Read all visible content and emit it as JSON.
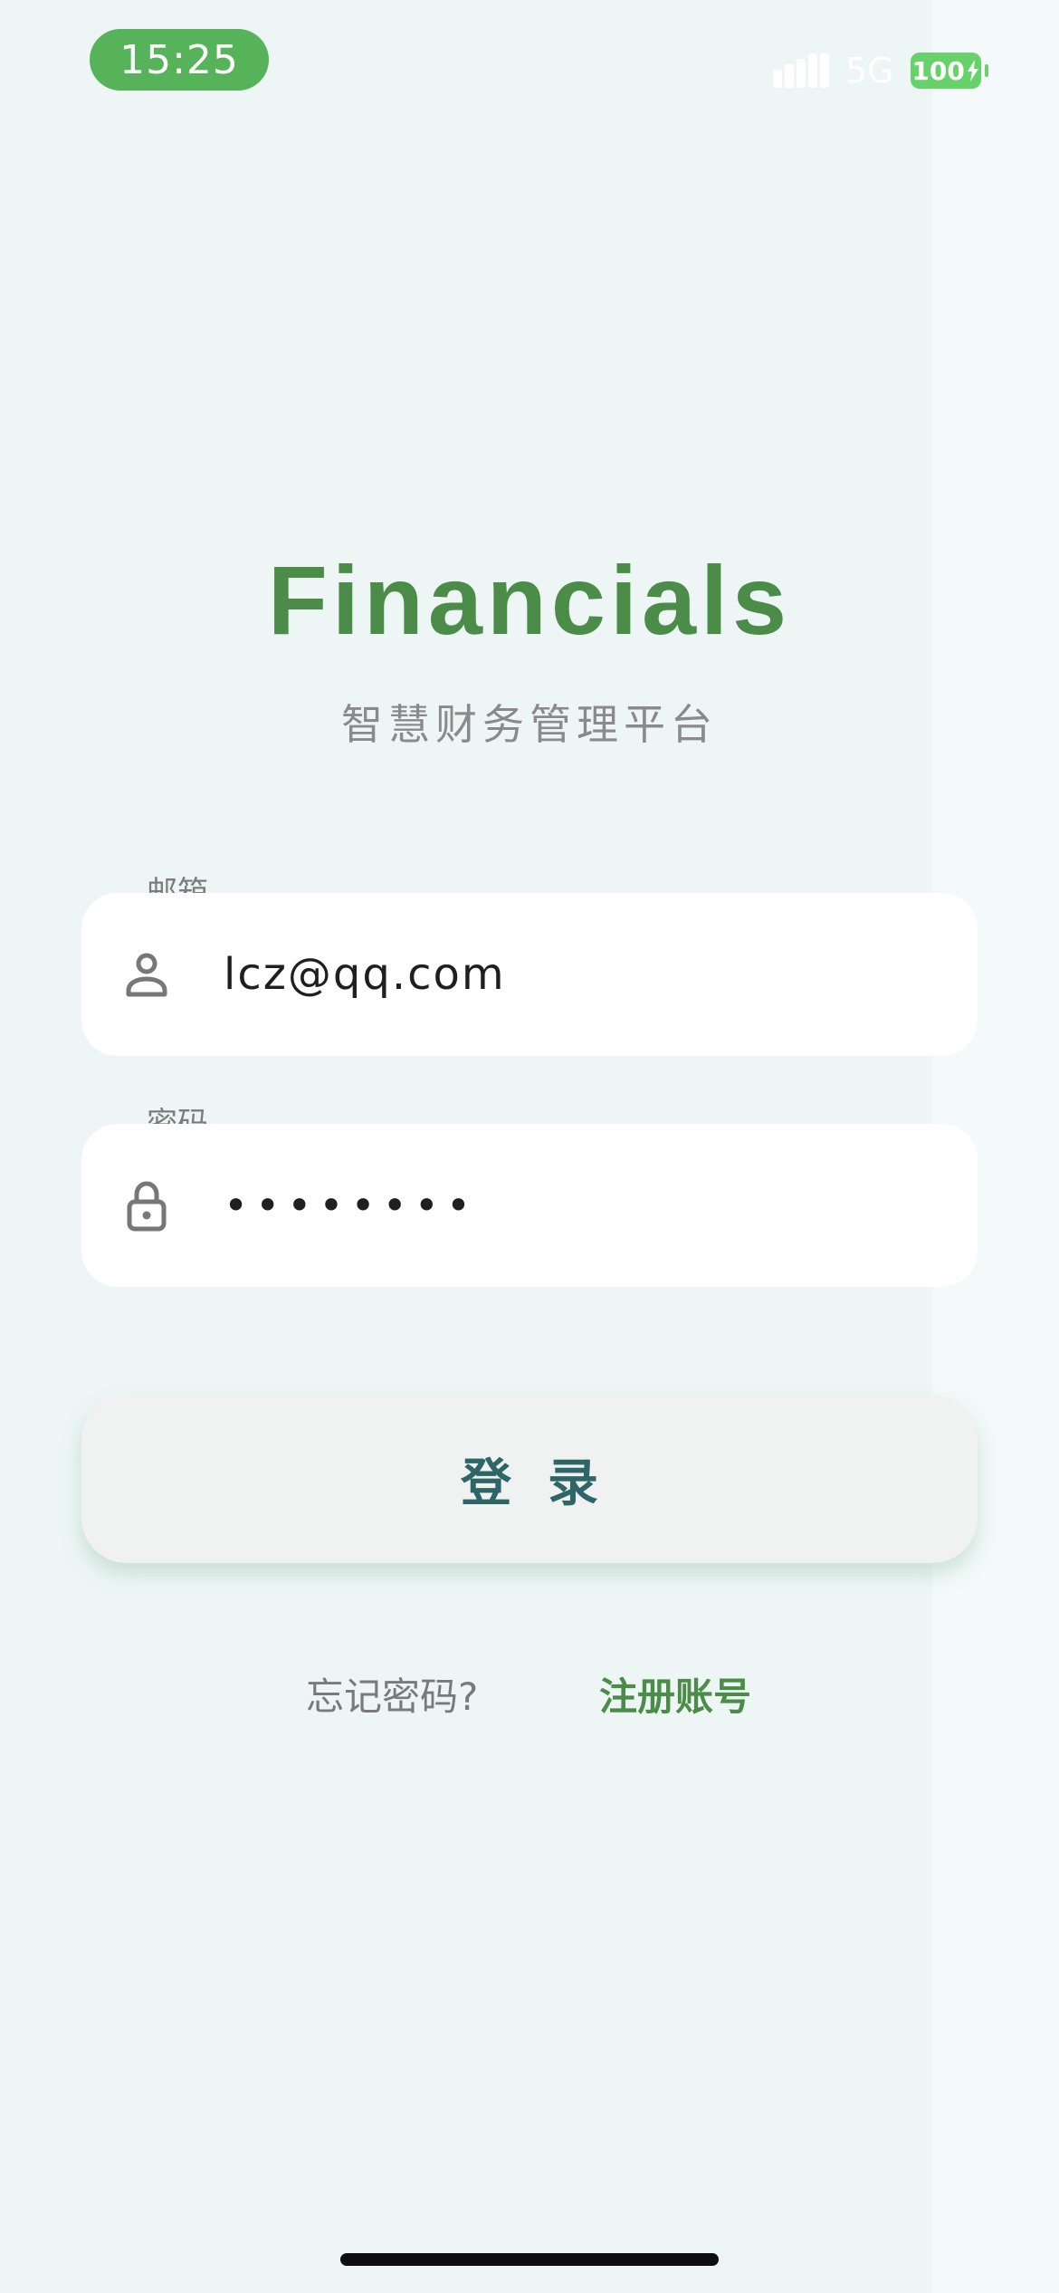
{
  "status_bar": {
    "time": "15:25",
    "network": "5G",
    "battery_level": "100",
    "battery_color": "#67d26a",
    "time_pill_color": "#57b35a"
  },
  "header": {
    "title": "Financials",
    "subtitle": "智慧财务管理平台",
    "title_color": "#4a8c48"
  },
  "form": {
    "email": {
      "label": "邮箱",
      "value": "lcz@qq.com",
      "icon": "user-icon"
    },
    "password": {
      "label": "密码",
      "value": "••••••••",
      "icon": "lock-icon"
    },
    "login_label": "登录",
    "login_text_color": "#2e6567"
  },
  "links": {
    "forgot": "忘记密码?",
    "register": "注册账号"
  }
}
